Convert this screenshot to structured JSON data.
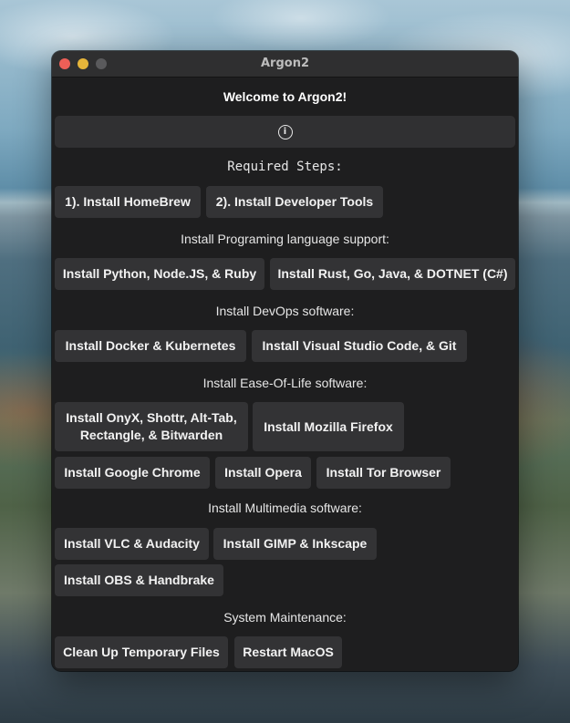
{
  "window": {
    "title": "Argon2"
  },
  "welcome": "Welcome to Argon2!",
  "info_icon": "info-icon",
  "sections": {
    "required": {
      "label": "Required Steps:",
      "buttons": [
        "1). Install HomeBrew",
        "2). Install Developer Tools"
      ]
    },
    "languages": {
      "label": "Install Programing language support:",
      "buttons": [
        "Install Python, Node.JS, & Ruby",
        "Install Rust, Go, Java, & DOTNET (C#)"
      ]
    },
    "devops": {
      "label": "Install DevOps software:",
      "buttons": [
        "Install Docker & Kubernetes",
        "Install Visual Studio Code, & Git"
      ]
    },
    "easeoflife": {
      "label": "Install Ease-Of-Life software:",
      "buttons": [
        "Install OnyX, Shottr, Alt-Tab, Rectangle, & Bitwarden",
        "Install Mozilla Firefox",
        "Install Google Chrome",
        "Install Opera",
        "Install Tor Browser"
      ]
    },
    "multimedia": {
      "label": "Install Multimedia software:",
      "buttons": [
        "Install VLC & Audacity",
        "Install GIMP & Inkscape",
        "Install OBS & Handbrake"
      ]
    },
    "maintenance": {
      "label": "System Maintenance:",
      "buttons": [
        "Clean Up Temporary Files",
        "Restart MacOS"
      ]
    }
  }
}
